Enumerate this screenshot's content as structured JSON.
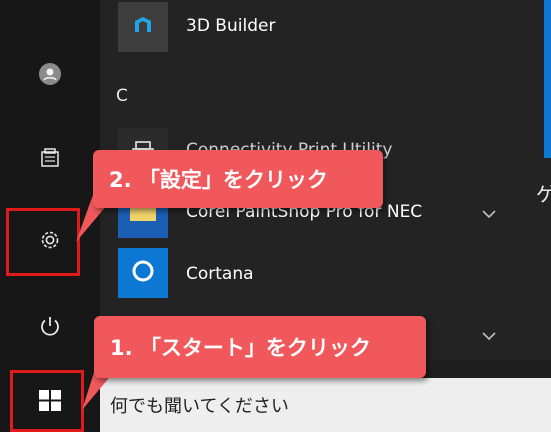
{
  "start_menu": {
    "apps": [
      {
        "label": "3D Builder",
        "icon": "3d-builder-icon"
      },
      {
        "label": "Connectivity Print Utility",
        "icon": "printer-icon"
      },
      {
        "label": "Corel PaintShop Pro for NEC",
        "icon": "folder-icon"
      },
      {
        "label": "Cortana",
        "icon": "cortana-circle-icon"
      }
    ],
    "section_letter": "C",
    "right_tile_char": "ゲ"
  },
  "rail": {
    "icons": [
      "user-icon",
      "documents-icon",
      "settings-gear-icon",
      "power-icon",
      "windows-start-icon"
    ]
  },
  "search": {
    "placeholder": "何でも聞いてください"
  },
  "annotations": {
    "step1": "1. 「スタート」をクリック",
    "step2": "2. 「設定」をクリック"
  },
  "colors": {
    "accent": "#0d78d4",
    "callout": "#f1585c",
    "highlight_border": "#e01b1b"
  }
}
